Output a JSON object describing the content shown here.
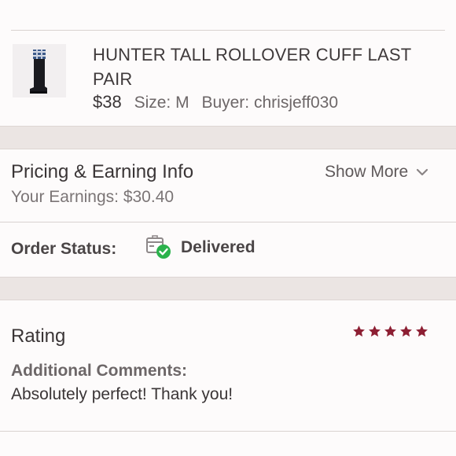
{
  "item": {
    "title": "HUNTER TALL ROLLOVER CUFF LAST PAIR",
    "price": "$38",
    "size_label": "Size:",
    "size_value": "M",
    "buyer_label": "Buyer:",
    "buyer_value": "chrisjeff030",
    "image_icon": "rain-boot-image"
  },
  "pricing": {
    "title": "Pricing & Earning Info",
    "earnings": "Your Earnings: $30.40",
    "show_more": "Show More"
  },
  "order": {
    "label": "Order Status:",
    "status": "Delivered",
    "status_color": "#2bb24c"
  },
  "rating": {
    "label": "Rating",
    "stars": 5,
    "star_color": "#8d1f33",
    "comments_label": "Additional Comments:",
    "comments": "Absolutely perfect! Thank you!"
  }
}
